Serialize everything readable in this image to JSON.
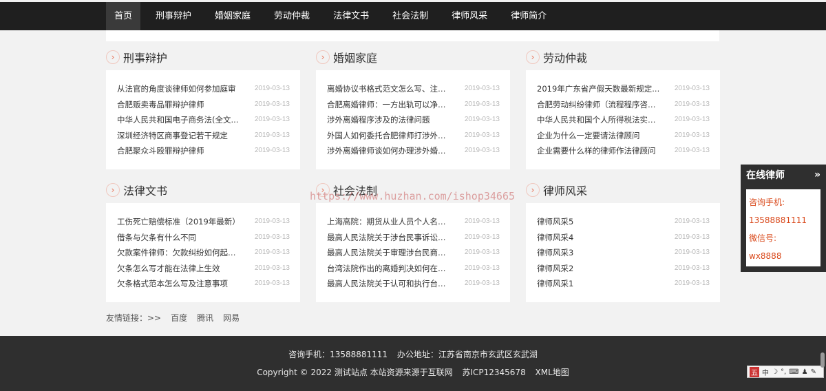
{
  "nav": {
    "items": [
      "首页",
      "刑事辩护",
      "婚姻家庭",
      "劳动仲裁",
      "法律文书",
      "社会法制",
      "律师风采",
      "律师简介"
    ]
  },
  "sections": [
    {
      "title": "刑事辩护",
      "items": [
        {
          "title": "从法官的角度谈律师如何参加庭审",
          "date": "2019-03-13"
        },
        {
          "title": "合肥贩卖毒品罪辩护律师",
          "date": "2019-03-13"
        },
        {
          "title": "中华人民共和国电子商务法(全文...",
          "date": "2019-03-13"
        },
        {
          "title": "深圳经济特区商事登记若干规定",
          "date": "2019-03-13"
        },
        {
          "title": "合肥聚众斗殴罪辩护律师",
          "date": "2019-03-13"
        }
      ]
    },
    {
      "title": "婚姻家庭",
      "items": [
        {
          "title": "离婚协议书格式范文怎么写、注意...",
          "date": "2019-03-13"
        },
        {
          "title": "合肥离婚律师：一方出轨可以净身...",
          "date": "2019-03-13"
        },
        {
          "title": "涉外离婚程序涉及的法律问题",
          "date": "2019-03-13"
        },
        {
          "title": "外国人如何委托合肥律师打涉外离...",
          "date": "2019-03-13"
        },
        {
          "title": "涉外离婚律师谈如何办理涉外婚姻...",
          "date": "2019-03-13"
        }
      ]
    },
    {
      "title": "劳动仲裁",
      "items": [
        {
          "title": "2019年广东省产假天数最新规定...",
          "date": "2019-03-13"
        },
        {
          "title": "合肥劳动纠纷律师（流程程序咨询）",
          "date": "2019-03-13"
        },
        {
          "title": "中华人民共和国个人所得税法实施...",
          "date": "2019-03-13"
        },
        {
          "title": "企业为什么一定要请法律顾问",
          "date": "2019-03-13"
        },
        {
          "title": "企业需要什么样的律师作法律顾问",
          "date": "2019-03-13"
        }
      ]
    },
    {
      "title": "法律文书",
      "items": [
        {
          "title": "工伤死亡赔偿标准（2019年最新）",
          "date": "2019-03-13"
        },
        {
          "title": "借条与欠条有什么不同",
          "date": "2019-03-13"
        },
        {
          "title": "欠款案件律师：欠款纠纷如何起诉...",
          "date": "2019-03-13"
        },
        {
          "title": "欠条怎么写才能在法律上生效",
          "date": "2019-03-13"
        },
        {
          "title": "欠条格式范本怎么写及注意事项",
          "date": "2019-03-13"
        }
      ]
    },
    {
      "title": "社会法制",
      "items": [
        {
          "title": "上海高院：期货从业人员个人名义...",
          "date": "2019-03-13"
        },
        {
          "title": "最高人民法院关于涉台民事诉讼文...",
          "date": "2019-03-13"
        },
        {
          "title": "最高人民法院关于审理涉台民商事...",
          "date": "2019-03-13"
        },
        {
          "title": "台湾法院作出的离婚判决如何在大...",
          "date": "2019-03-13"
        },
        {
          "title": "最高人民法院关于认可和执行台湾...",
          "date": "2019-03-13"
        }
      ]
    },
    {
      "title": "律师风采",
      "items": [
        {
          "title": "律师风采5",
          "date": "2019-03-13"
        },
        {
          "title": "律师风采4",
          "date": "2019-03-13"
        },
        {
          "title": "律师风采3",
          "date": "2019-03-13"
        },
        {
          "title": "律师风采2",
          "date": "2019-03-13"
        },
        {
          "title": "律师风采1",
          "date": "2019-03-13"
        }
      ]
    }
  ],
  "friend_links": {
    "label": "友情链接：>>",
    "links": [
      "百度",
      "腾讯",
      "网易"
    ]
  },
  "footer": {
    "phone": "咨询手机：13588881111",
    "address": "办公地址：江苏省南京市玄武区玄武湖",
    "copyright": "Copyright © 2022 测试站点 本站资源来源于互联网",
    "icp": "苏ICP12345678",
    "sitemap": "XML地图"
  },
  "online": {
    "title": "在线律师",
    "collapse_glyph": "»",
    "phone_label": "咨询手机:",
    "phone": "13588881111",
    "wechat_label": "微信号:",
    "wechat": "wx8888"
  },
  "watermark": "https://www.huzhan.com/ishop34665",
  "ime": {
    "lang": "中"
  },
  "colors": {
    "nav_bg": "#1f1f1f",
    "accent": "#e96f52",
    "footer_bg": "#2f2f2f",
    "online_text": "#d9481a"
  }
}
